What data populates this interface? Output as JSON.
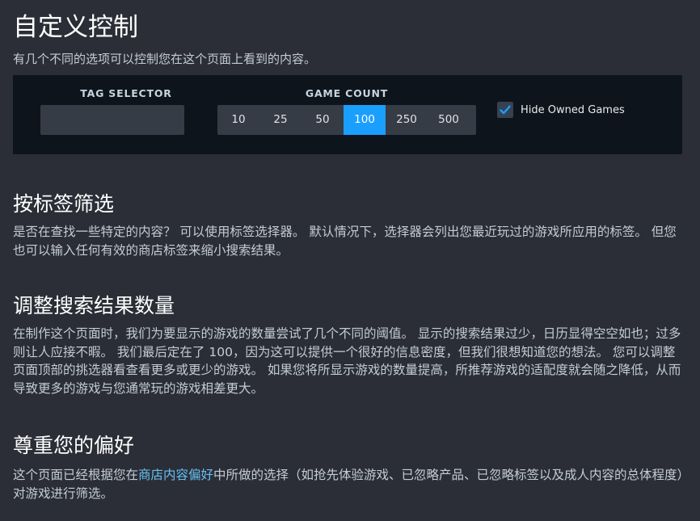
{
  "header": {
    "title": "自定义控制",
    "subtitle": "有几个不同的选项可以控制您在这个页面上看到的内容。"
  },
  "controls": {
    "tag_selector_label": "TAG SELECTOR",
    "tag_selector_value": "",
    "tag_selector_placeholder": "",
    "game_count_label": "GAME COUNT",
    "game_count_options": [
      "10",
      "25",
      "50",
      "100",
      "250",
      "500"
    ],
    "game_count_selected": "100",
    "hide_owned_label": "Hide Owned Games",
    "hide_owned_checked": true
  },
  "sections": {
    "filter_by_tag": {
      "heading": "按标签筛选",
      "body": "是否在查找一些特定的内容？ 可以使用标签选择器。 默认情况下，选择器会列出您最近玩过的游戏所应用的标签。 但您也可以输入任何有效的商店标签来缩小搜索结果。"
    },
    "adjust_count": {
      "heading": "调整搜索结果数量",
      "body": "在制作这个页面时，我们为要显示的游戏的数量尝试了几个不同的阈值。 显示的搜索结果过少，日历显得空空如也；过多则让人应接不暇。 我们最后定在了 100，因为这可以提供一个很好的信息密度，但我们很想知道您的想法。 您可以调整页面顶部的挑选器看查看更多或更少的游戏。 如果您将所显示游戏的数量提高，所推荐游戏的适配度就会随之降低，从而导致更多的游戏与您通常玩的游戏相差更大。"
    },
    "preferences": {
      "heading": "尊重您的偏好",
      "body_before": "这个页面已经根据您在",
      "link": "商店内容偏好",
      "body_after": "中所做的选择（如抢先体验游戏、已忽略产品、已忽略标签以及成人内容的总体程度）对游戏进行筛选。"
    }
  },
  "colors": {
    "background": "#2b2e36",
    "panel": "#0e141b",
    "accent": "#1a9fff",
    "link": "#66c0f4"
  }
}
